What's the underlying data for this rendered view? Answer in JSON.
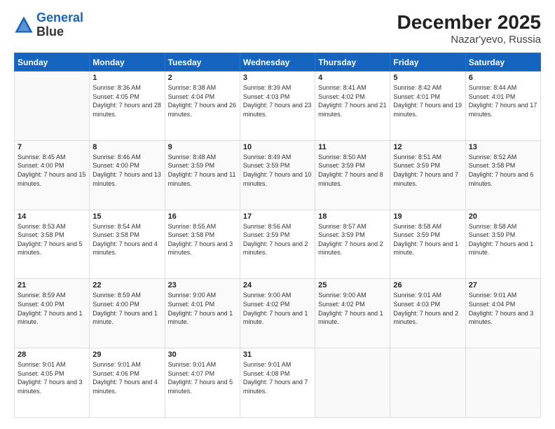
{
  "header": {
    "logo_line1": "General",
    "logo_line2": "Blue",
    "title": "December 2025",
    "subtitle": "Nazar'yevo, Russia"
  },
  "days_of_week": [
    "Sunday",
    "Monday",
    "Tuesday",
    "Wednesday",
    "Thursday",
    "Friday",
    "Saturday"
  ],
  "weeks": [
    [
      {
        "day": "",
        "sunrise": "",
        "sunset": "",
        "daylight": ""
      },
      {
        "day": "1",
        "sunrise": "Sunrise: 8:36 AM",
        "sunset": "Sunset: 4:05 PM",
        "daylight": "Daylight: 7 hours and 28 minutes."
      },
      {
        "day": "2",
        "sunrise": "Sunrise: 8:38 AM",
        "sunset": "Sunset: 4:04 PM",
        "daylight": "Daylight: 7 hours and 26 minutes."
      },
      {
        "day": "3",
        "sunrise": "Sunrise: 8:39 AM",
        "sunset": "Sunset: 4:03 PM",
        "daylight": "Daylight: 7 hours and 23 minutes."
      },
      {
        "day": "4",
        "sunrise": "Sunrise: 8:41 AM",
        "sunset": "Sunset: 4:02 PM",
        "daylight": "Daylight: 7 hours and 21 minutes."
      },
      {
        "day": "5",
        "sunrise": "Sunrise: 8:42 AM",
        "sunset": "Sunset: 4:01 PM",
        "daylight": "Daylight: 7 hours and 19 minutes."
      },
      {
        "day": "6",
        "sunrise": "Sunrise: 8:44 AM",
        "sunset": "Sunset: 4:01 PM",
        "daylight": "Daylight: 7 hours and 17 minutes."
      }
    ],
    [
      {
        "day": "7",
        "sunrise": "Sunrise: 8:45 AM",
        "sunset": "Sunset: 4:00 PM",
        "daylight": "Daylight: 7 hours and 15 minutes."
      },
      {
        "day": "8",
        "sunrise": "Sunrise: 8:46 AM",
        "sunset": "Sunset: 4:00 PM",
        "daylight": "Daylight: 7 hours and 13 minutes."
      },
      {
        "day": "9",
        "sunrise": "Sunrise: 8:48 AM",
        "sunset": "Sunset: 3:59 PM",
        "daylight": "Daylight: 7 hours and 11 minutes."
      },
      {
        "day": "10",
        "sunrise": "Sunrise: 8:49 AM",
        "sunset": "Sunset: 3:59 PM",
        "daylight": "Daylight: 7 hours and 10 minutes."
      },
      {
        "day": "11",
        "sunrise": "Sunrise: 8:50 AM",
        "sunset": "Sunset: 3:59 PM",
        "daylight": "Daylight: 7 hours and 8 minutes."
      },
      {
        "day": "12",
        "sunrise": "Sunrise: 8:51 AM",
        "sunset": "Sunset: 3:59 PM",
        "daylight": "Daylight: 7 hours and 7 minutes."
      },
      {
        "day": "13",
        "sunrise": "Sunrise: 8:52 AM",
        "sunset": "Sunset: 3:58 PM",
        "daylight": "Daylight: 7 hours and 6 minutes."
      }
    ],
    [
      {
        "day": "14",
        "sunrise": "Sunrise: 8:53 AM",
        "sunset": "Sunset: 3:58 PM",
        "daylight": "Daylight: 7 hours and 5 minutes."
      },
      {
        "day": "15",
        "sunrise": "Sunrise: 8:54 AM",
        "sunset": "Sunset: 3:58 PM",
        "daylight": "Daylight: 7 hours and 4 minutes."
      },
      {
        "day": "16",
        "sunrise": "Sunrise: 8:55 AM",
        "sunset": "Sunset: 3:58 PM",
        "daylight": "Daylight: 7 hours and 3 minutes."
      },
      {
        "day": "17",
        "sunrise": "Sunrise: 8:56 AM",
        "sunset": "Sunset: 3:59 PM",
        "daylight": "Daylight: 7 hours and 2 minutes."
      },
      {
        "day": "18",
        "sunrise": "Sunrise: 8:57 AM",
        "sunset": "Sunset: 3:59 PM",
        "daylight": "Daylight: 7 hours and 2 minutes."
      },
      {
        "day": "19",
        "sunrise": "Sunrise: 8:58 AM",
        "sunset": "Sunset: 3:59 PM",
        "daylight": "Daylight: 7 hours and 1 minute."
      },
      {
        "day": "20",
        "sunrise": "Sunrise: 8:58 AM",
        "sunset": "Sunset: 3:59 PM",
        "daylight": "Daylight: 7 hours and 1 minute."
      }
    ],
    [
      {
        "day": "21",
        "sunrise": "Sunrise: 8:59 AM",
        "sunset": "Sunset: 4:00 PM",
        "daylight": "Daylight: 7 hours and 1 minute."
      },
      {
        "day": "22",
        "sunrise": "Sunrise: 8:59 AM",
        "sunset": "Sunset: 4:00 PM",
        "daylight": "Daylight: 7 hours and 1 minute."
      },
      {
        "day": "23",
        "sunrise": "Sunrise: 9:00 AM",
        "sunset": "Sunset: 4:01 PM",
        "daylight": "Daylight: 7 hours and 1 minute."
      },
      {
        "day": "24",
        "sunrise": "Sunrise: 9:00 AM",
        "sunset": "Sunset: 4:02 PM",
        "daylight": "Daylight: 7 hours and 1 minute."
      },
      {
        "day": "25",
        "sunrise": "Sunrise: 9:00 AM",
        "sunset": "Sunset: 4:02 PM",
        "daylight": "Daylight: 7 hours and 1 minute."
      },
      {
        "day": "26",
        "sunrise": "Sunrise: 9:01 AM",
        "sunset": "Sunset: 4:03 PM",
        "daylight": "Daylight: 7 hours and 2 minutes."
      },
      {
        "day": "27",
        "sunrise": "Sunrise: 9:01 AM",
        "sunset": "Sunset: 4:04 PM",
        "daylight": "Daylight: 7 hours and 3 minutes."
      }
    ],
    [
      {
        "day": "28",
        "sunrise": "Sunrise: 9:01 AM",
        "sunset": "Sunset: 4:05 PM",
        "daylight": "Daylight: 7 hours and 3 minutes."
      },
      {
        "day": "29",
        "sunrise": "Sunrise: 9:01 AM",
        "sunset": "Sunset: 4:06 PM",
        "daylight": "Daylight: 7 hours and 4 minutes."
      },
      {
        "day": "30",
        "sunrise": "Sunrise: 9:01 AM",
        "sunset": "Sunset: 4:07 PM",
        "daylight": "Daylight: 7 hours and 5 minutes."
      },
      {
        "day": "31",
        "sunrise": "Sunrise: 9:01 AM",
        "sunset": "Sunset: 4:08 PM",
        "daylight": "Daylight: 7 hours and 7 minutes."
      },
      {
        "day": "",
        "sunrise": "",
        "sunset": "",
        "daylight": ""
      },
      {
        "day": "",
        "sunrise": "",
        "sunset": "",
        "daylight": ""
      },
      {
        "day": "",
        "sunrise": "",
        "sunset": "",
        "daylight": ""
      }
    ]
  ]
}
